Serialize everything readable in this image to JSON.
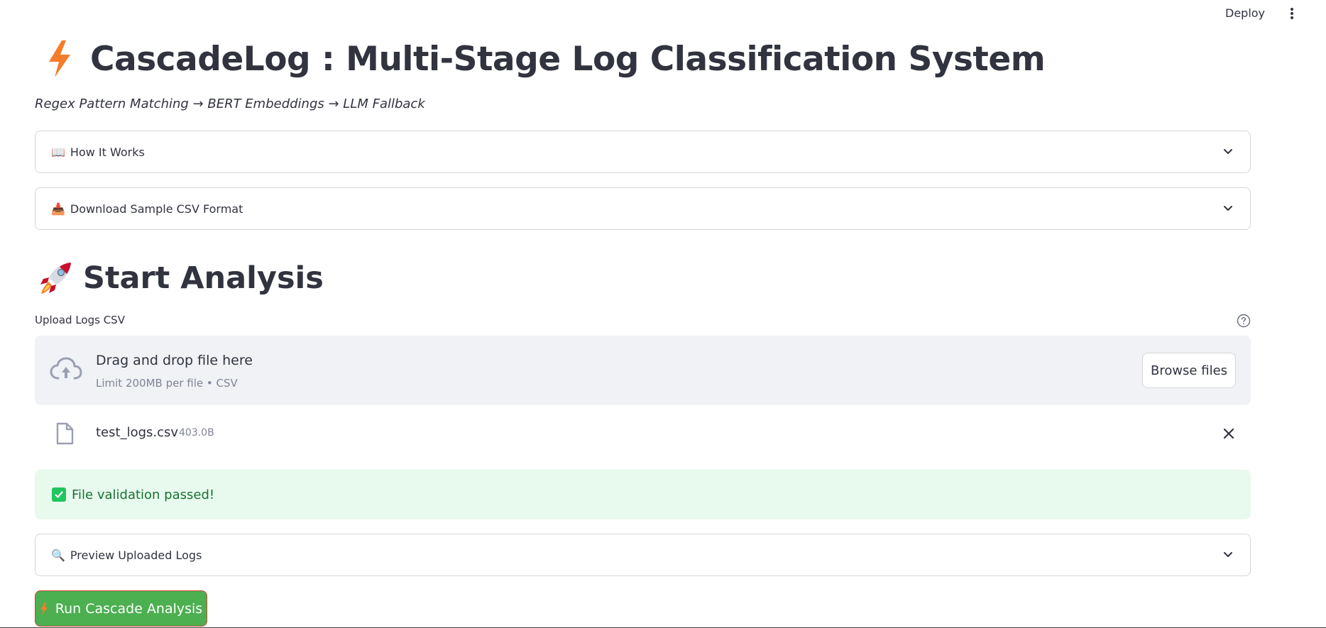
{
  "header": {
    "deploy_label": "Deploy"
  },
  "page": {
    "title": "CascadeLog : Multi-Stage Log Classification System",
    "subtitle": "Regex Pattern Matching → BERT Embeddings → LLM Fallback"
  },
  "expanders": {
    "how_it_works": {
      "emoji": "📖",
      "label": "How It Works"
    },
    "download_sample": {
      "emoji": "📥",
      "label": "Download Sample CSV Format"
    },
    "preview_logs": {
      "emoji": "🔍",
      "label": "Preview Uploaded Logs"
    }
  },
  "analysis": {
    "title": "Start Analysis"
  },
  "uploader": {
    "label": "Upload Logs CSV",
    "dropzone_title": "Drag and drop file here",
    "dropzone_limit": "Limit 200MB per file • CSV",
    "browse_label": "Browse files"
  },
  "uploaded_file": {
    "name": "test_logs.csv",
    "size": "403.0B"
  },
  "alert": {
    "message": "File validation passed!"
  },
  "run_button": {
    "label": "Run Cascade Analysis"
  },
  "colors": {
    "accent_orange": "#f57c2a",
    "success_bg": "#e8f9ee",
    "success_text": "#177233",
    "run_button_bg": "#4caf50"
  }
}
